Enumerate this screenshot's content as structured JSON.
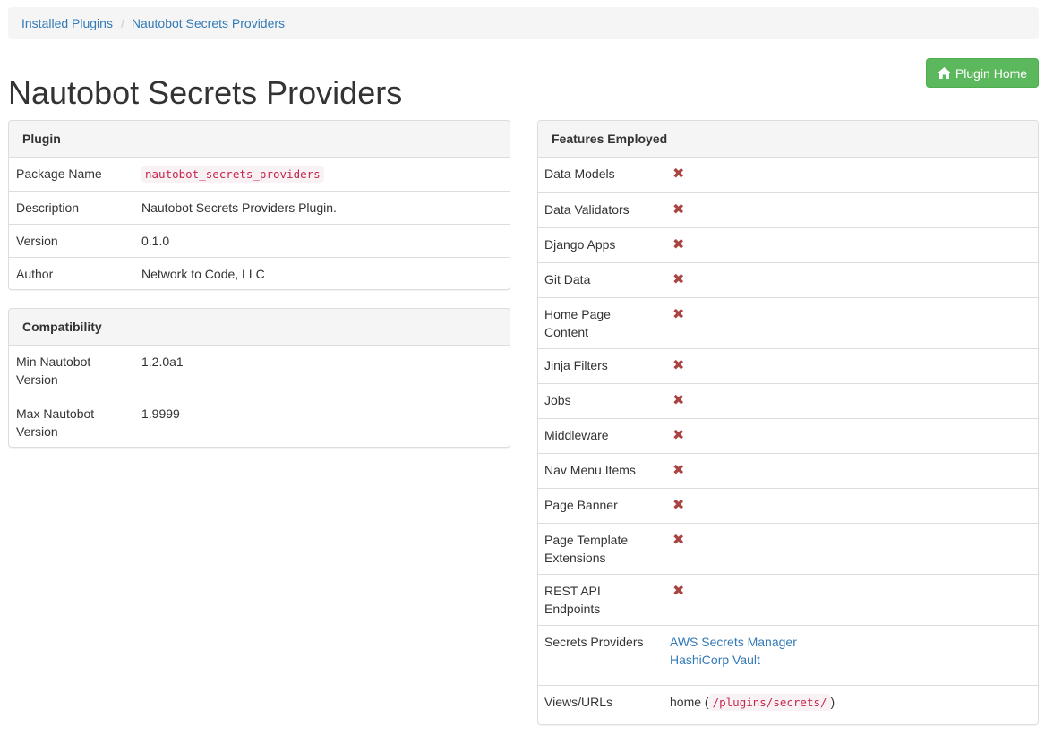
{
  "breadcrumb": [
    "Installed Plugins",
    "Nautobot Secrets Providers"
  ],
  "title": "Nautobot Secrets Providers",
  "home_button": {
    "label": "Plugin Home",
    "icon": "home-icon"
  },
  "plugin_panel": {
    "heading": "Plugin",
    "rows": [
      {
        "label": "Package Name",
        "value": "nautobot_secrets_providers"
      },
      {
        "label": "Description",
        "value": "Nautobot Secrets Providers Plugin."
      },
      {
        "label": "Version",
        "value": "0.1.0"
      },
      {
        "label": "Author",
        "value": "Network to Code, LLC"
      }
    ]
  },
  "compat_panel": {
    "heading": "Compatibility",
    "rows": [
      {
        "label": "Min Nautobot Version",
        "value": "1.2.0a1"
      },
      {
        "label": "Max Nautobot Version",
        "value": "1.9999"
      }
    ]
  },
  "features_panel": {
    "heading": "Features Employed",
    "unused_mark": "✖",
    "rows": [
      {
        "label": "Data Models"
      },
      {
        "label": "Data Validators"
      },
      {
        "label": "Django Apps"
      },
      {
        "label": "Git Data"
      },
      {
        "label": "Home Page Content"
      },
      {
        "label": "Jinja Filters"
      },
      {
        "label": "Jobs"
      },
      {
        "label": "Middleware"
      },
      {
        "label": "Nav Menu Items"
      },
      {
        "label": "Page Banner"
      },
      {
        "label": "Page Template Extensions"
      },
      {
        "label": "REST API Endpoints"
      }
    ],
    "secrets_providers": {
      "label": "Secrets Providers",
      "links": [
        "AWS Secrets Manager",
        "HashiCorp Vault"
      ]
    },
    "views": {
      "label": "Views/URLs",
      "name": "home",
      "open": " (",
      "path": "/plugins/secrets/",
      "close": ")"
    }
  },
  "colors": {
    "link": "#337ab7",
    "success": "#5cb85c",
    "danger": "#a94442",
    "code": "#c7254e"
  }
}
